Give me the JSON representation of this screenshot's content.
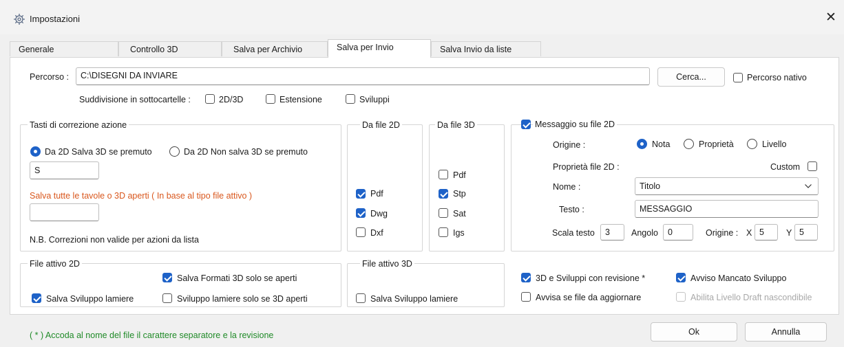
{
  "window": {
    "title": "Impostazioni",
    "close_glyph": "✕",
    "icon": "gear-icon"
  },
  "tabs": [
    "Generale",
    "Controllo 3D",
    "Salva per Archivio",
    "Salva per Invio",
    "Salva Invio da liste"
  ],
  "active_tab": "Salva per Invio",
  "percorso": {
    "label": "Percorso :",
    "value": "C:\\DISEGNI DA INVIARE",
    "cerca_button": "Cerca...",
    "nativo_label": "Percorso nativo",
    "nativo_checked": false
  },
  "suddivisione": {
    "label": "Suddivisione in sottocartelle :",
    "options": [
      {
        "label": "2D/3D",
        "checked": false
      },
      {
        "label": "Estensione",
        "checked": false
      },
      {
        "label": "Sviluppi",
        "checked": false
      }
    ]
  },
  "tasti": {
    "title": "Tasti di correzione azione",
    "radio1": "Da 2D Salva 3D se premuto",
    "radio2": "Da 2D Non salva 3D se premuto",
    "selected": "radio1",
    "key1_value": "S",
    "salva_tutte_label": "Salva tutte le tavole o 3D aperti ( In base al tipo file attivo )",
    "key2_value": "",
    "nb_note": "N.B. Correzioni non valide per azioni da lista"
  },
  "da_file_2d": {
    "title": "Da file 2D",
    "items": [
      {
        "label": "Pdf",
        "checked": true
      },
      {
        "label": "Dwg",
        "checked": true
      },
      {
        "label": "Dxf",
        "checked": false
      }
    ]
  },
  "da_file_3d": {
    "title": "Da file 3D",
    "items": [
      {
        "label": "Pdf",
        "checked": false
      },
      {
        "label": "Stp",
        "checked": true
      },
      {
        "label": "Sat",
        "checked": false
      },
      {
        "label": "Igs",
        "checked": false
      }
    ]
  },
  "messaggio": {
    "title": "Messaggio su file 2D",
    "checked": true,
    "origine_label": "Origine :",
    "origine_options": [
      "Nota",
      "Proprietà",
      "Livello"
    ],
    "origine_selected": "Nota",
    "proprieta_label": "Proprietà file 2D :",
    "custom_label": "Custom",
    "custom_checked": false,
    "nome_label": "Nome :",
    "nome_value": "Titolo",
    "testo_label": "Testo :",
    "testo_value": "MESSAGGIO",
    "scala_label": "Scala testo",
    "scala_value": "3",
    "angolo_label": "Angolo",
    "angolo_value": "0",
    "origine_xy_label": "Origine :",
    "x_label": "X",
    "x_value": "5",
    "y_label": "Y",
    "y_value": "5"
  },
  "file_attivo_2d": {
    "title": "File attivo 2D",
    "formati_3d": {
      "label": "Salva Formati 3D solo se aperti",
      "checked": true
    },
    "sviluppo": {
      "label": "Salva Sviluppo lamiere",
      "checked": true
    },
    "sviluppo_3d": {
      "label": "Sviluppo lamiere solo se 3D aperti",
      "checked": false
    }
  },
  "file_attivo_3d": {
    "title": "File attivo 3D",
    "sviluppo": {
      "label": "Salva Sviluppo lamiere",
      "checked": false
    }
  },
  "options_right": {
    "revisione": {
      "label": "3D e Sviluppi con revisione *",
      "checked": true
    },
    "avviso_mancato": {
      "label": "Avviso Mancato Sviluppo",
      "checked": true
    },
    "avvisa_aggiornare": {
      "label": "Avvisa se file da aggiornare",
      "checked": false
    },
    "abilita_livello": {
      "label": "Abilita Livello Draft nascondibile",
      "checked": false,
      "disabled": true
    }
  },
  "footer": {
    "note": "( * ) Accoda al nome del file il carattere separatore e la revisione",
    "ok": "Ok",
    "annulla": "Annulla"
  },
  "colors": {
    "accent": "#1e62c8",
    "warning_text": "#d9571d",
    "note_text": "#1f8a27"
  }
}
